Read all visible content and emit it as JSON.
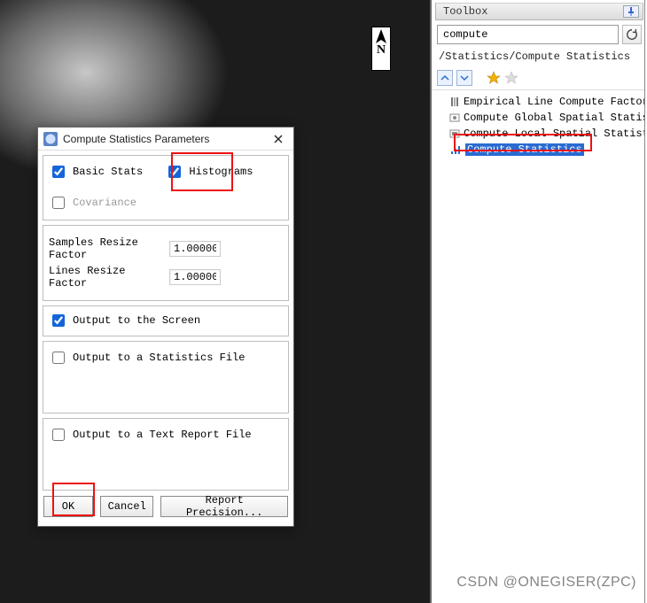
{
  "north_label": "N",
  "toolbox": {
    "title": "Toolbox",
    "search_value": "compute",
    "breadcrumb": "/Statistics/Compute Statistics",
    "tree": [
      {
        "label": "Empirical Line Compute Factors a",
        "selected": false
      },
      {
        "label": "Compute Global Spatial Statistic",
        "selected": false
      },
      {
        "label": "Compute Local Spatial Statistic:",
        "selected": false
      },
      {
        "label": "Compute Statistics",
        "selected": true
      }
    ]
  },
  "dialog": {
    "title": "Compute Statistics Parameters",
    "basic_stats": {
      "label": "Basic Stats",
      "checked": true
    },
    "histograms": {
      "label": "Histograms",
      "checked": true
    },
    "covariance": {
      "label": "Covariance",
      "checked": false
    },
    "samples_resize": {
      "label": "Samples Resize Factor",
      "value": "1.00000"
    },
    "lines_resize": {
      "label": "Lines Resize Factor",
      "value": "1.00000"
    },
    "output_screen": {
      "label": "Output to the Screen",
      "checked": true
    },
    "output_stats_file": {
      "label": "Output to a Statistics File",
      "checked": false
    },
    "output_text_file": {
      "label": "Output to a Text Report File",
      "checked": false
    },
    "buttons": {
      "ok": "OK",
      "cancel": "Cancel",
      "report_precision": "Report Precision..."
    }
  },
  "watermark": "CSDN @ONEGISER(ZPC)"
}
